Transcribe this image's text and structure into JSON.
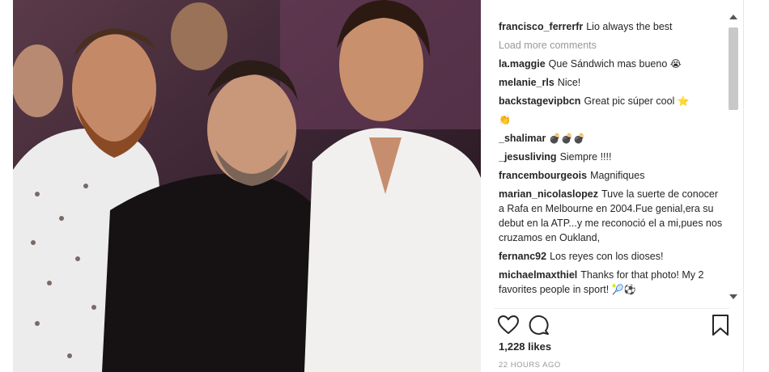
{
  "post": {
    "caption_user": "francisco_ferrerfr",
    "caption_text": "Lio always the best",
    "load_more": "Load more comments",
    "comments": [
      {
        "user": "la.maggie",
        "text": "Que Sándwich mas bueno",
        "emoji": "😭"
      },
      {
        "user": "melanie_rls",
        "text": "Nice!",
        "emoji": ""
      },
      {
        "user": "backstagevipbcn",
        "text": "Great pic súper cool",
        "emoji": "⭐"
      },
      {
        "user": "",
        "text": "",
        "emoji": "👏"
      },
      {
        "user": "_shalimar",
        "text": "",
        "emoji": "💣💣💣"
      },
      {
        "user": "_jesusliving",
        "text": "Siempre !!!!",
        "emoji": ""
      },
      {
        "user": "francembourgeois",
        "text": "Magnifiques",
        "emoji": ""
      },
      {
        "user": "marian_nicolaslopez",
        "text": "Tuve la suerte de conocer a Rafa en Melbourne en 2004.Fue genial,era su debut en la ATP...y me reconoció el a mi,pues nos cruzamos en Oukland,",
        "emoji": ""
      },
      {
        "user": "fernanc92",
        "text": "Los reyes con los dioses!",
        "emoji": ""
      },
      {
        "user": "michaelmaxthiel",
        "text": "Thanks for that photo! My 2 favorites people in sport!",
        "emoji": "🎾⚽"
      }
    ],
    "likes": "1,228 likes",
    "timestamp": "22 HOURS AGO"
  },
  "icons": {
    "like": "heart-icon",
    "comment": "comment-icon",
    "save": "bookmark-icon"
  }
}
